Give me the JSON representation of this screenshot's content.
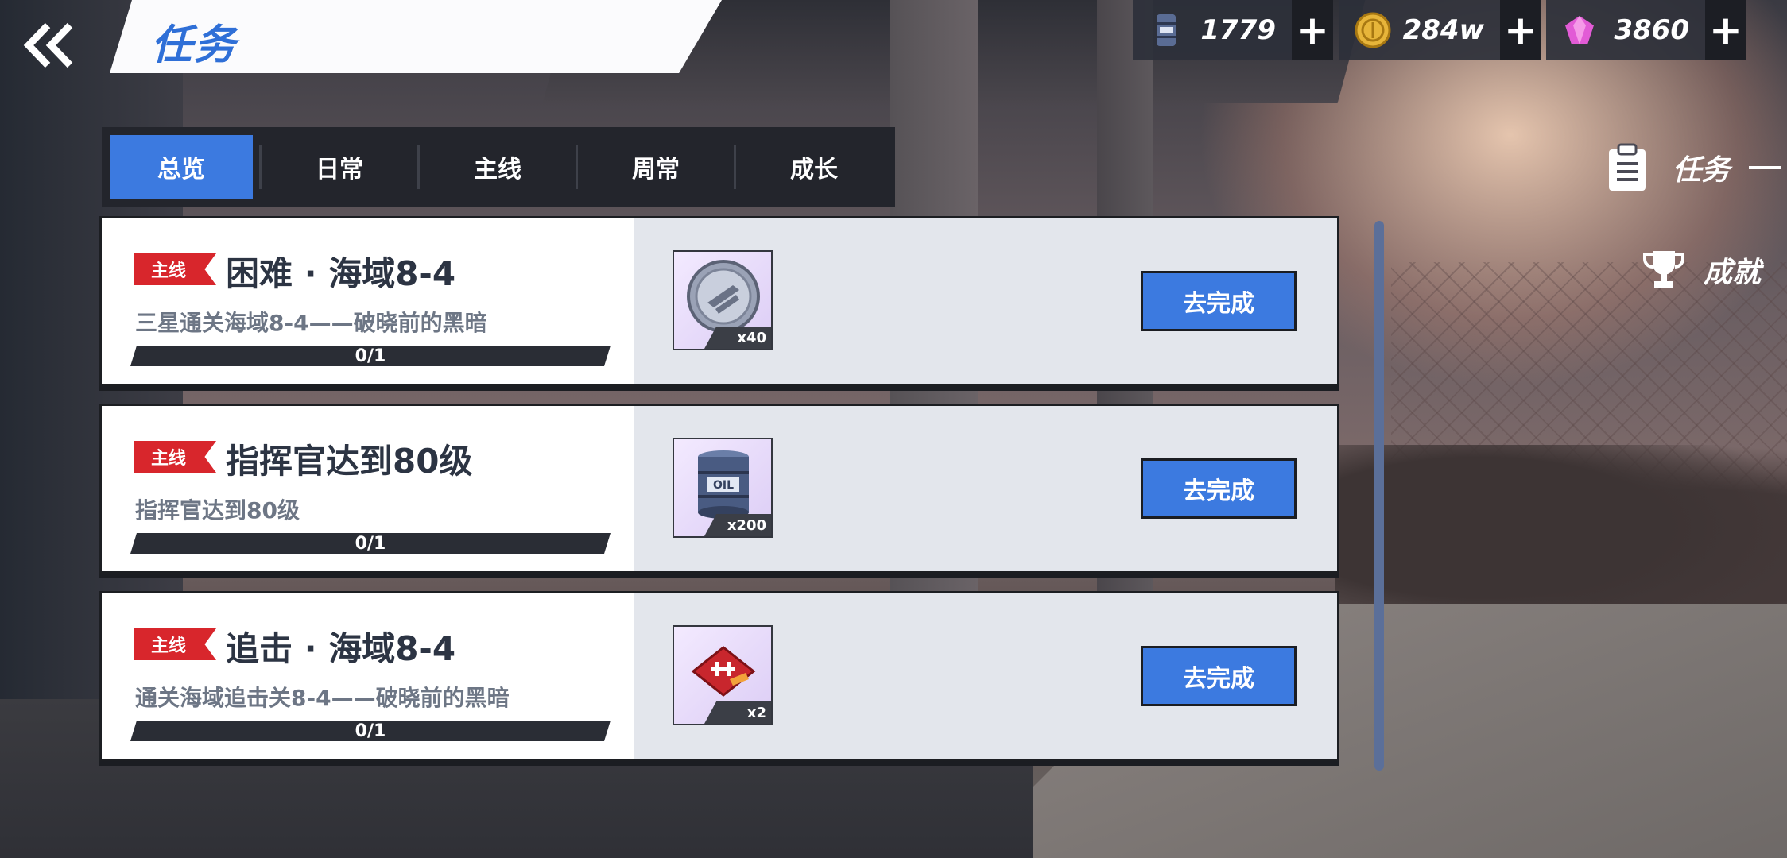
{
  "header": {
    "title": "任务",
    "back_icon": "double-chevron-left-icon"
  },
  "currency": [
    {
      "name": "oil",
      "icon": "oil-barrel-icon",
      "value": "1779"
    },
    {
      "name": "gold",
      "icon": "gold-coin-icon",
      "value": "284w"
    },
    {
      "name": "gem",
      "icon": "gem-icon",
      "value": "3860"
    }
  ],
  "tabs": [
    {
      "label": "总览",
      "active": true
    },
    {
      "label": "日常"
    },
    {
      "label": "主线"
    },
    {
      "label": "周常"
    },
    {
      "label": "成长"
    }
  ],
  "tasks": [
    {
      "tag": "主线",
      "title": "困难 · 海域8-4",
      "desc": "三星通关海域8-4——破晓前的黑暗",
      "progress": "0/1",
      "reward_icon": "silver-medal-icon",
      "reward_qty": "x40",
      "button": "去完成"
    },
    {
      "tag": "主线",
      "title": "指挥官达到80级",
      "desc": "指挥官达到80级",
      "progress": "0/1",
      "reward_icon": "oil-barrel-icon",
      "reward_qty": "x200",
      "reward_text": "OIL",
      "button": "去完成"
    },
    {
      "tag": "主线",
      "title": "追击 · 海域8-4",
      "desc": "通关海域追击关8-4——破晓前的黑暗",
      "progress": "0/1",
      "reward_icon": "red-ticket-icon",
      "reward_qty": "x2",
      "button": "去完成"
    }
  ],
  "side": {
    "tasks_label": "任务",
    "tasks_icon": "clipboard-icon",
    "achievements_label": "成就",
    "achievements_icon": "trophy-icon"
  },
  "colors": {
    "accent": "#3c7ae0",
    "tag_red": "#d8262c",
    "panel_dark": "#23252c"
  }
}
